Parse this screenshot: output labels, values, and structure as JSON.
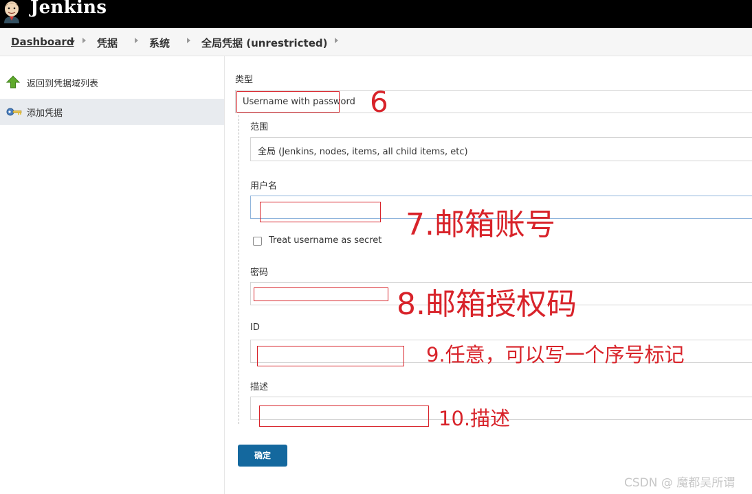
{
  "header": {
    "brand": "Jenkins"
  },
  "breadcrumb": {
    "items": [
      "Dashboard",
      "凭据",
      "系统",
      "全局凭据 (unrestricted)"
    ]
  },
  "sidebar": {
    "items": [
      {
        "label": "返回到凭据域列表",
        "icon": "up-arrow-icon"
      },
      {
        "label": "添加凭据",
        "icon": "key-icon"
      }
    ]
  },
  "form": {
    "kind_label": "类型",
    "kind_value": "Username with password",
    "scope_label": "范围",
    "scope_value": "全局 (Jenkins, nodes, items, all child items, etc)",
    "username_label": "用户名",
    "username_value": "",
    "treat_secret_label": "Treat username as secret",
    "treat_secret_checked": false,
    "password_label": "密码",
    "password_value": "",
    "id_label": "ID",
    "id_value": "",
    "description_label": "描述",
    "description_value": "",
    "submit_label": "确定"
  },
  "annotations": {
    "a6": "6",
    "a7": "7.邮箱账号",
    "a8": "8.邮箱授权码",
    "a9": "9.任意，可以写一个序号标记",
    "a10": "10.描述",
    "color": "#d8232a"
  },
  "watermark": "CSDN @ 魔都吴所谓"
}
